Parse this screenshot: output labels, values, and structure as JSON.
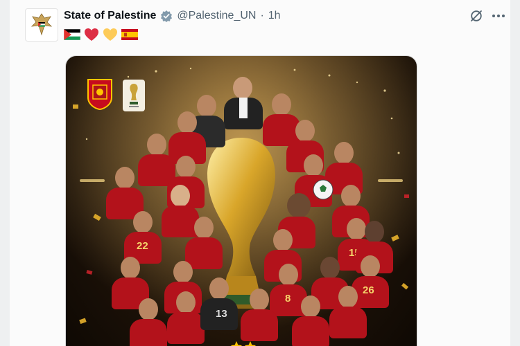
{
  "post": {
    "author_name": "State of Palestine",
    "handle": "@Palestine_UN",
    "separator": "·",
    "time": "1h",
    "verified": true,
    "emojis": [
      "palestine-flag",
      "red-heart",
      "yellow-heart",
      "spain-flag"
    ]
  },
  "media": {
    "jersey_numbers": [
      "22",
      "15",
      "26",
      "8",
      "13"
    ]
  },
  "colors": {
    "name": "#0f1419",
    "secondary": "#536471",
    "verified_badge": "#829aab",
    "spain_red": "#c60b1e",
    "spain_yellow": "#ffc400"
  }
}
